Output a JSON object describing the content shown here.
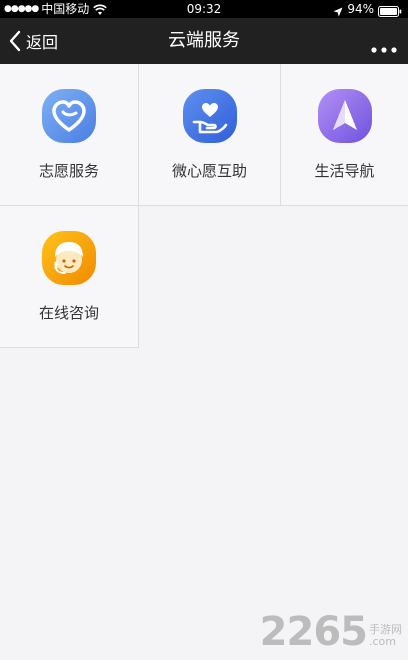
{
  "status_bar": {
    "signal": "●●●●●",
    "carrier": "中国移动",
    "time": "09:32",
    "battery": "94%",
    "icons": [
      "wifi-icon",
      "location-icon",
      "battery-icon"
    ]
  },
  "nav": {
    "back_label": "返回",
    "title": "云端服务",
    "more_icon": "more-dots-icon"
  },
  "services": [
    {
      "label": "志愿服务",
      "icon": "heart-icon",
      "color": "#5b8de8"
    },
    {
      "label": "微心愿互助",
      "icon": "heart-hand-icon",
      "color": "#3d6fe0"
    },
    {
      "label": "生活导航",
      "icon": "navigation-arrow-icon",
      "color": "#8a6be8"
    },
    {
      "label": "在线咨询",
      "icon": "support-agent-icon",
      "color": "#f5a000"
    }
  ],
  "watermark": {
    "number": "2265",
    "site": "手游网",
    "domain": ".com"
  }
}
